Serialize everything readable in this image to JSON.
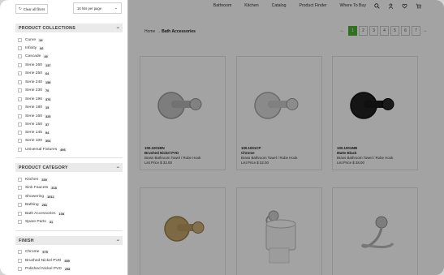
{
  "header": {
    "nav": [
      "Bathroom",
      "Kitchen",
      "Catalog",
      "Product Finder",
      "Where To Buy"
    ],
    "icons": [
      "search-icon",
      "user-icon",
      "heart-icon",
      "cart-icon"
    ]
  },
  "breadcrumb": {
    "home": "Home",
    "sep": "→",
    "current": "Bath Accessories"
  },
  "pagination": {
    "prev": "←",
    "pages": [
      "1",
      "2",
      "3",
      "4",
      "5",
      "6",
      "7"
    ],
    "active": "1",
    "next": "→"
  },
  "products": [
    {
      "sku": "100.1001BN",
      "finish": "Brushed Nickel PVD",
      "desc": "Brass Bathroom Towel / Robe Hook",
      "price": "List Price $ 32.00",
      "color": "#b9b9b9"
    },
    {
      "sku": "100.1001CP",
      "finish": "Chrome",
      "desc": "Brass Bathroom Towel / Robe Hook",
      "price": "List Price $ 32.00",
      "color": "#cfcfcf"
    },
    {
      "sku": "100.1001MB",
      "finish": "Matte Black",
      "desc": "Brass Bathroom Towel / Robe Hook",
      "price": "List Price $ 38.00",
      "color": "#1e1e1e"
    },
    {
      "sku": "",
      "finish": "",
      "desc": "",
      "price": "",
      "color": "#b79a62"
    },
    {
      "sku": "",
      "finish": "",
      "desc": "",
      "price": "",
      "color": "#c9c9c9"
    },
    {
      "sku": "",
      "finish": "",
      "desc": "",
      "price": "",
      "color": "#b5b5b5"
    }
  ],
  "drawer": {
    "clear_label": "Clear all filters",
    "per_page": "16 hits per page",
    "sections": {
      "collections": {
        "title": "PRODUCT COLLECTIONS",
        "items": [
          {
            "label": "Curve",
            "count": "19"
          },
          {
            "label": "Infinity",
            "count": "66"
          },
          {
            "label": "Cascade",
            "count": "49"
          },
          {
            "label": "Serie 260",
            "count": "137"
          },
          {
            "label": "Serie 250",
            "count": "64"
          },
          {
            "label": "Serie 240",
            "count": "158"
          },
          {
            "label": "Serie 230",
            "count": "70"
          },
          {
            "label": "Serie 196",
            "count": "376"
          },
          {
            "label": "Serie 180",
            "count": "15"
          },
          {
            "label": "Serie 160",
            "count": "325"
          },
          {
            "label": "Serie 150",
            "count": "37"
          },
          {
            "label": "Serie 145",
            "count": "94"
          },
          {
            "label": "Serie 100",
            "count": "304"
          },
          {
            "label": "Universal Fixtures",
            "count": "496"
          }
        ]
      },
      "category": {
        "title": "PRODUCT CATEGORY",
        "items": [
          {
            "label": "Kitchen",
            "count": "339"
          },
          {
            "label": "Sink Faucets",
            "count": "318"
          },
          {
            "label": "Showering",
            "count": "1511"
          },
          {
            "label": "Bathing",
            "count": "281"
          },
          {
            "label": "Bath Accessories",
            "count": "108"
          },
          {
            "label": "Spare Parts",
            "count": "31"
          }
        ]
      },
      "finish": {
        "title": "FINISH",
        "items": [
          {
            "label": "Chrome",
            "count": "975"
          },
          {
            "label": "Brushed Nickel PVD",
            "count": "459"
          },
          {
            "label": "Polished Nickel PVD",
            "count": "298"
          }
        ]
      }
    }
  }
}
